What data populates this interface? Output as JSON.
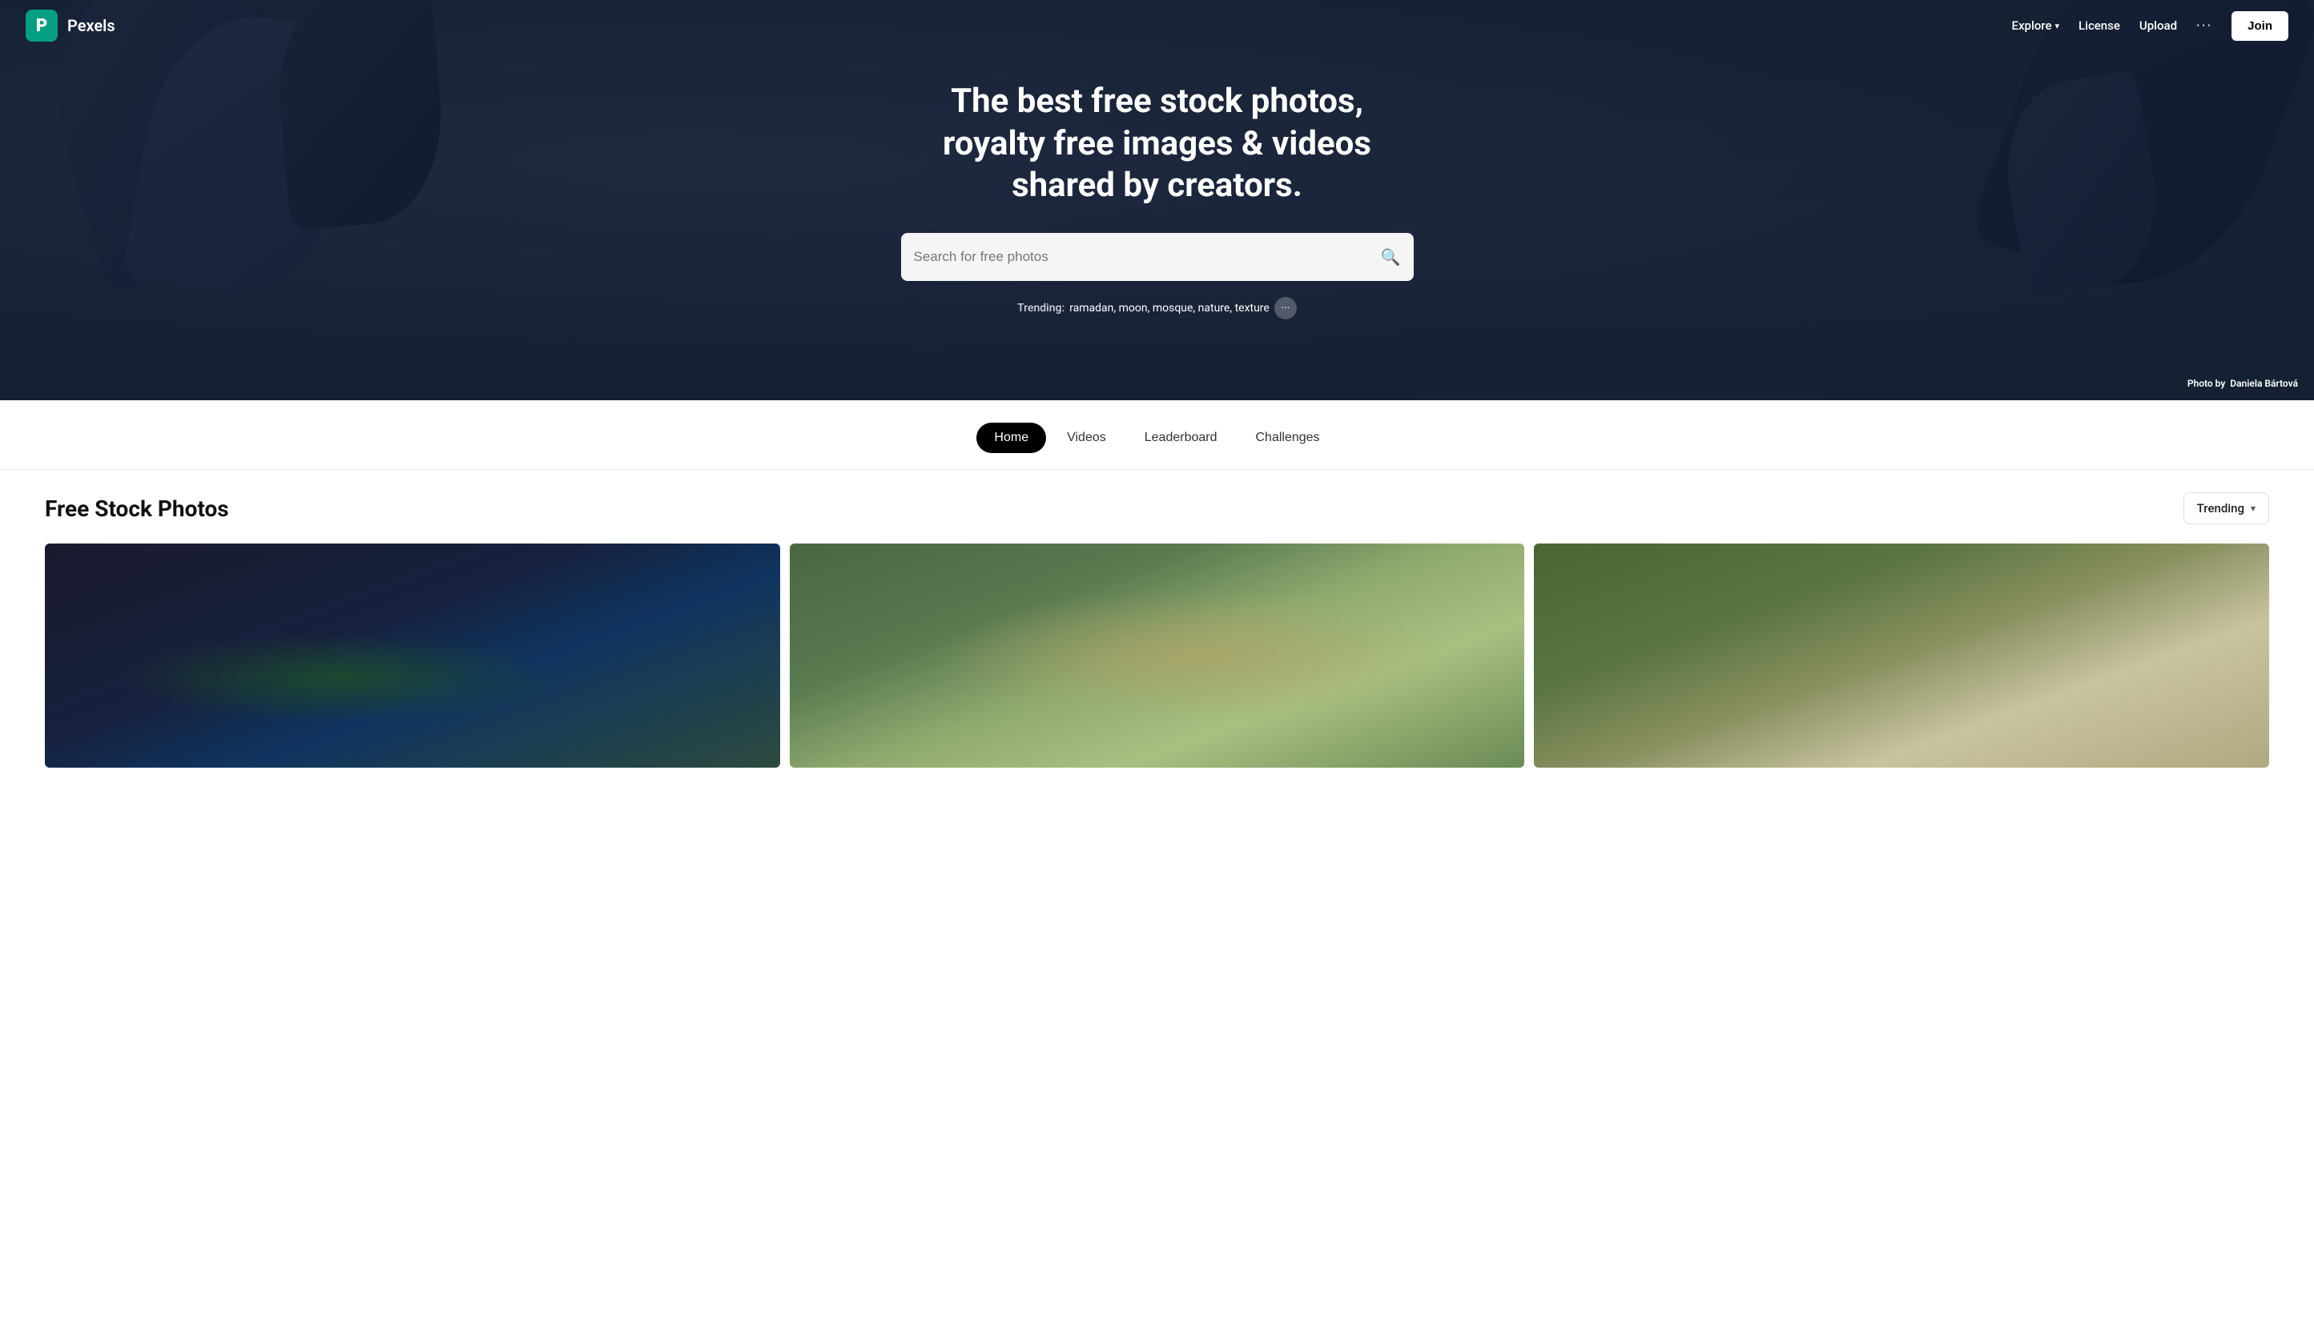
{
  "brand": {
    "logo_letter": "P",
    "name": "Pexels"
  },
  "navbar": {
    "explore_label": "Explore",
    "license_label": "License",
    "upload_label": "Upload",
    "more_label": "···",
    "join_label": "Join"
  },
  "hero": {
    "title": "The best free stock photos, royalty free images & videos shared by creators.",
    "search_placeholder": "Search for free photos",
    "trending_label": "Trending:",
    "trending_terms": "ramadan, moon, mosque, nature, texture",
    "photo_credit_prefix": "Photo by",
    "photo_credit_author": "Daniela Bártová"
  },
  "tabs": [
    {
      "label": "Home",
      "active": true
    },
    {
      "label": "Videos",
      "active": false
    },
    {
      "label": "Leaderboard",
      "active": false
    },
    {
      "label": "Challenges",
      "active": false
    }
  ],
  "content": {
    "section_title": "Free Stock Photos",
    "sort_label": "Trending",
    "photos": [
      {
        "id": 1,
        "style": "card-1"
      },
      {
        "id": 2,
        "style": "card-2"
      },
      {
        "id": 3,
        "style": "card-3"
      }
    ]
  },
  "icons": {
    "search": "🔍",
    "chevron_down": "▾",
    "ellipsis_circle": "···"
  }
}
